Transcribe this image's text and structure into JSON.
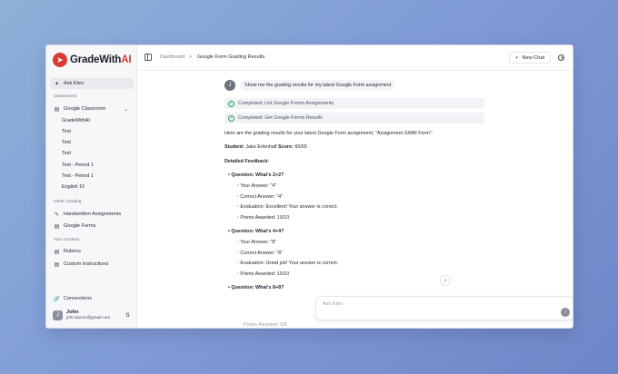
{
  "brand": {
    "name_prefix": "GradeWith",
    "name_suffix": "AI"
  },
  "sidebar": {
    "ask": "Ask Kleo",
    "classrooms_label": "Classrooms",
    "google_classroom": "Google Classroom",
    "classes": [
      "GradeWithAI",
      "Test",
      "Test",
      "Test",
      "Test - Period 1",
      "Test - Period 1",
      "English 10"
    ],
    "other_label": "Other Grading",
    "handwritten": "Handwritten Assignments",
    "google_forms": "Google Forms",
    "content_label": "Your Content",
    "rubrics": "Rubrics",
    "custom_instructions": "Custom Instructions",
    "connections": "Connections",
    "user": {
      "initial": "J",
      "name": "John",
      "email": "john.tian31@gmail.com"
    }
  },
  "header": {
    "crumb_root": "Dashboard",
    "separator": ">",
    "crumb_current": "Google Form Grading Results",
    "new_chat": "New Chat"
  },
  "chat": {
    "user_initial": "J",
    "user_message": "Show me the grading results for my latest Google Form assignment",
    "tool_1": "Completed: List Google Forms Assignments",
    "tool_2": "Completed: Get Google Forms Results",
    "intro": "Here are the grading results for your latest Google Form assignment, \"Assignment GWAI Form\":",
    "student_label": "Student:",
    "student_value": "Jake Erlenhalf",
    "score_label": "Score:",
    "score_value": "60/65",
    "feedback_heading": "Detailed Feedback:",
    "q1": {
      "title": "Question: What's 2+2?",
      "answer": "Your Answer: \"4\"",
      "correct": "Correct Answer: \"4\"",
      "evaluation": "Evaluation: Excellent! Your answer is correct.",
      "points": "Points Awarded: 10/10"
    },
    "q2": {
      "title": "Question: What's 4+4?",
      "answer": "Your Answer: \"8\"",
      "correct": "Correct Answer: \"8\"",
      "evaluation": "Evaluation: Great job! Your answer is correct.",
      "points": "Points Awarded: 10/10"
    },
    "q3": {
      "title": "Question: What's 8+8?",
      "points_partial": "Points Awarded: 5/5"
    }
  },
  "input": {
    "placeholder": "Ask Kleo"
  }
}
